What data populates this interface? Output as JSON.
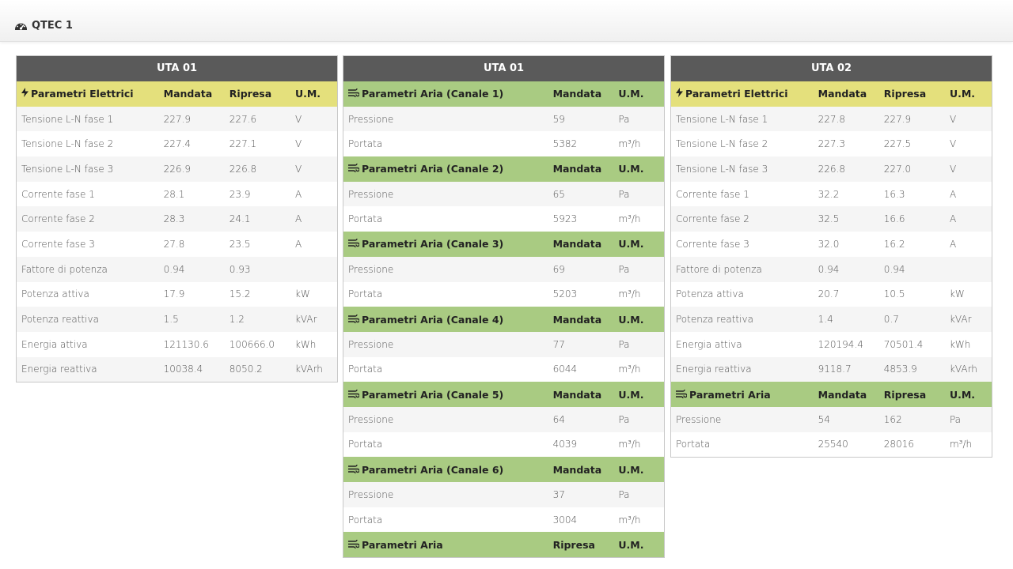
{
  "page": {
    "title": "QTEC 1",
    "title_icon": "dashboard-gauge-icon"
  },
  "colors": {
    "panel_header": "#5a5a5a",
    "electric_header": "#e4e07c",
    "air_header": "#a9cb82",
    "row_alt": "#f5f5f5"
  },
  "panel1": {
    "title": "UTA 01",
    "header": {
      "label": "Parametri Elettrici",
      "icon": "bolt-icon",
      "col_a": "Mandata",
      "col_b": "Ripresa",
      "col_u": "U.M."
    },
    "rows": [
      {
        "label": "Tensione L-N fase 1",
        "a": "227.9",
        "b": "227.6",
        "u": "V"
      },
      {
        "label": "Tensione L-N fase 2",
        "a": "227.4",
        "b": "227.1",
        "u": "V"
      },
      {
        "label": "Tensione L-N fase 3",
        "a": "226.9",
        "b": "226.8",
        "u": "V"
      },
      {
        "label": "Corrente fase 1",
        "a": "28.1",
        "b": "23.9",
        "u": "A"
      },
      {
        "label": "Corrente fase 2",
        "a": "28.3",
        "b": "24.1",
        "u": "A"
      },
      {
        "label": "Corrente fase 3",
        "a": "27.8",
        "b": "23.5",
        "u": "A"
      },
      {
        "label": "Fattore di potenza",
        "a": "0.94",
        "b": "0.93",
        "u": ""
      },
      {
        "label": "Potenza attiva",
        "a": "17.9",
        "b": "15.2",
        "u": "kW"
      },
      {
        "label": "Potenza reattiva",
        "a": "1.5",
        "b": "1.2",
        "u": "kVAr"
      },
      {
        "label": "Energia attiva",
        "a": "121130.6",
        "b": "100666.0",
        "u": "kWh"
      },
      {
        "label": "Energia reattiva",
        "a": "10038.4",
        "b": "8050.2",
        "u": "kVArh"
      }
    ]
  },
  "panel2": {
    "title": "UTA 01",
    "sections": [
      {
        "label": "Parametri Aria (Canale 1)",
        "icon": "air-flow-icon",
        "col_a": "Mandata",
        "col_u": "U.M.",
        "rows": [
          {
            "label": "Pressione",
            "a": "59",
            "u": "Pa"
          },
          {
            "label": "Portata",
            "a": "5382",
            "u": "m³/h"
          }
        ]
      },
      {
        "label": "Parametri Aria (Canale 2)",
        "icon": "air-flow-icon",
        "col_a": "Mandata",
        "col_u": "U.M.",
        "rows": [
          {
            "label": "Pressione",
            "a": "65",
            "u": "Pa"
          },
          {
            "label": "Portata",
            "a": "5923",
            "u": "m³/h"
          }
        ]
      },
      {
        "label": "Parametri Aria (Canale 3)",
        "icon": "air-flow-icon",
        "col_a": "Mandata",
        "col_u": "U.M.",
        "rows": [
          {
            "label": "Pressione",
            "a": "69",
            "u": "Pa"
          },
          {
            "label": "Portata",
            "a": "5203",
            "u": "m³/h"
          }
        ]
      },
      {
        "label": "Parametri Aria (Canale 4)",
        "icon": "air-flow-icon",
        "col_a": "Mandata",
        "col_u": "U.M.",
        "rows": [
          {
            "label": "Pressione",
            "a": "77",
            "u": "Pa"
          },
          {
            "label": "Portata",
            "a": "6044",
            "u": "m³/h"
          }
        ]
      },
      {
        "label": "Parametri Aria (Canale 5)",
        "icon": "air-flow-icon",
        "col_a": "Mandata",
        "col_u": "U.M.",
        "rows": [
          {
            "label": "Pressione",
            "a": "64",
            "u": "Pa"
          },
          {
            "label": "Portata",
            "a": "4039",
            "u": "m³/h"
          }
        ]
      },
      {
        "label": "Parametri Aria (Canale 6)",
        "icon": "air-flow-icon",
        "col_a": "Mandata",
        "col_u": "U.M.",
        "rows": [
          {
            "label": "Pressione",
            "a": "37",
            "u": "Pa"
          },
          {
            "label": "Portata",
            "a": "3004",
            "u": "m³/h"
          }
        ]
      },
      {
        "label": "Parametri Aria",
        "icon": "air-flow-icon",
        "col_a": "Ripresa",
        "col_u": "U.M.",
        "rows": []
      }
    ]
  },
  "panel3": {
    "title": "UTA 02",
    "header": {
      "label": "Parametri Elettrici",
      "icon": "bolt-icon",
      "col_a": "Mandata",
      "col_b": "Ripresa",
      "col_u": "U.M."
    },
    "rows": [
      {
        "label": "Tensione L-N fase 1",
        "a": "227.8",
        "b": "227.9",
        "u": "V"
      },
      {
        "label": "Tensione L-N fase 2",
        "a": "227.3",
        "b": "227.5",
        "u": "V"
      },
      {
        "label": "Tensione L-N fase 3",
        "a": "226.8",
        "b": "227.0",
        "u": "V"
      },
      {
        "label": "Corrente fase 1",
        "a": "32.2",
        "b": "16.3",
        "u": "A"
      },
      {
        "label": "Corrente fase 2",
        "a": "32.5",
        "b": "16.6",
        "u": "A"
      },
      {
        "label": "Corrente fase 3",
        "a": "32.0",
        "b": "16.2",
        "u": "A"
      },
      {
        "label": "Fattore di potenza",
        "a": "0.94",
        "b": "0.94",
        "u": ""
      },
      {
        "label": "Potenza attiva",
        "a": "20.7",
        "b": "10.5",
        "u": "kW"
      },
      {
        "label": "Potenza reattiva",
        "a": "1.4",
        "b": "0.7",
        "u": "kVAr"
      },
      {
        "label": "Energia attiva",
        "a": "120194.4",
        "b": "70501.4",
        "u": "kWh"
      },
      {
        "label": "Energia reattiva",
        "a": "9118.7",
        "b": "4853.9",
        "u": "kVArh"
      }
    ],
    "air": {
      "header": {
        "label": "Parametri Aria",
        "icon": "air-flow-icon",
        "col_a": "Mandata",
        "col_b": "Ripresa",
        "col_u": "U.M."
      },
      "rows": [
        {
          "label": "Pressione",
          "a": "54",
          "b": "162",
          "u": "Pa"
        },
        {
          "label": "Portata",
          "a": "25540",
          "b": "28016",
          "u": "m³/h"
        }
      ]
    }
  }
}
